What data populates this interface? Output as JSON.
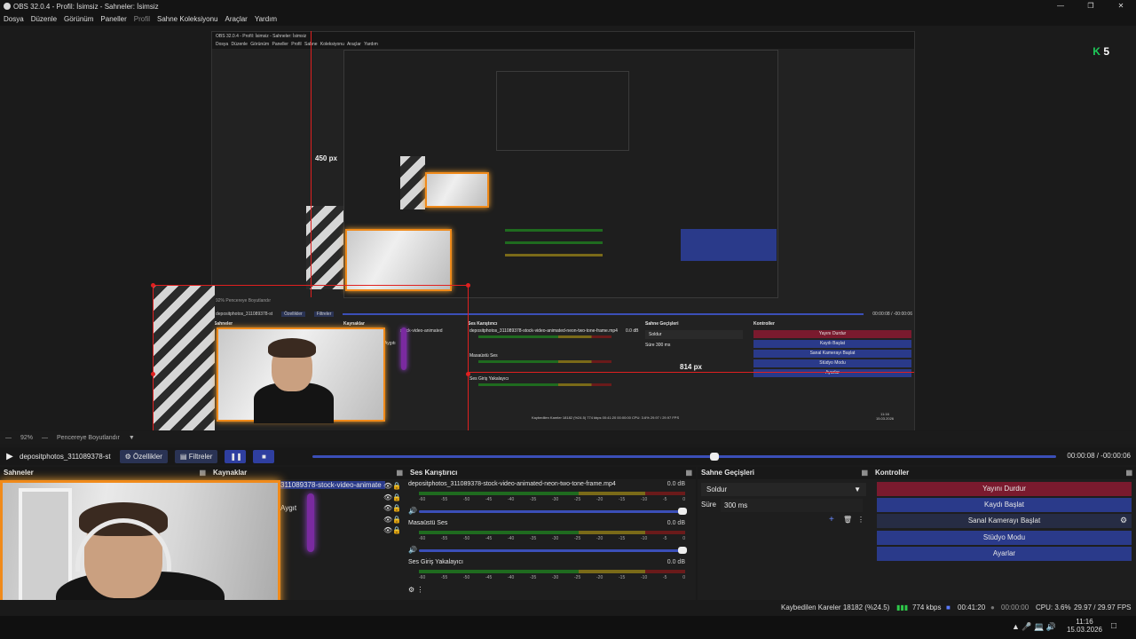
{
  "window": {
    "title": "OBS 32.0.4 - Profil: İsimsiz - Sahneler: İsimsiz"
  },
  "menu": [
    "Dosya",
    "Düzenle",
    "Görünüm",
    "Paneller",
    "Profil",
    "Sahne Koleksiyonu",
    "Araçlar",
    "Yardım"
  ],
  "logo": {
    "letter": "K",
    "num": "5"
  },
  "preview": {
    "inner_title": "OBS 32.0.4 - Profil: İsimsiz - Sahneler: İsimsiz",
    "inner_menu": "Dosya Düzenle Görünüm Paneller Profil Sahne Koleksiyonu Araçlar Yardım",
    "label_450": "450 px",
    "label_814": "814 px",
    "nested_source": "depositphotos_311089378-st",
    "nested_props": "Özellikler",
    "nested_filters": "Filtreler",
    "nested_time": "00:00:08 / -00:00:06",
    "nested_zoom": "92%",
    "nested_fit": "Pencereye Boyutlandır",
    "nested_scenes": "Sahneler",
    "nested_sources": "Kaynaklar",
    "nested_mixer": "Ses Karıştırıcı",
    "nested_trans": "Sahne Geçişleri",
    "nested_ctrl": "Kontroller",
    "nested_mix1": "depositphotos_311089378-stock-video-animated-neon-two-tone-frame.mp4",
    "nested_mix2": "Masaüstü Ses",
    "nested_mix3": "Ses Giriş Yakalayıcı",
    "nested_db": "0.0 dB",
    "nested_fade": "Soldur",
    "nested_dur_label": "Süre",
    "nested_dur": "300 ms",
    "nested_c1": "Yayını Durdur",
    "nested_c2": "Kaydı Başlat",
    "nested_c3": "Sanal Kamerayı Başlat",
    "nested_c4": "Stüdyo Modu",
    "nested_c5": "Ayarlar",
    "nested_src_item": "stock-video-animated",
    "nested_src_item2": "Aygıtı",
    "nested_status": "Kaybedilen Kareler 18182 (%24.5)    774 kbps    00:41:20    00:00:00   CPU: 3.6%  29.97 / 29.97 FPS",
    "nested_clock_time": "11:16",
    "nested_clock_date": "15.03.2026"
  },
  "statusrow": {
    "zoom": "92%",
    "fit": "Pencereye Boyutlandır"
  },
  "toolbar": {
    "source": "depositphotos_311089378-st",
    "props": "Özellikler",
    "filters": "Filtreler",
    "time": "00:00:08  /  -00:00:06",
    "seek_fraction": 0.54
  },
  "docks": {
    "scenes": "Sahneler",
    "sources": "Kaynaklar",
    "source_item": "311089378-stock-video-animate",
    "source_item2": "Aygıt",
    "mixer": "Ses Karıştırıcı",
    "transitions": "Sahne Geçişleri",
    "controls": "Kontroller"
  },
  "mixer": {
    "tracks": [
      {
        "name": "depositphotos_311089378-stock-video-animated-neon-two-tone-frame.mp4",
        "db": "0.0 dB"
      },
      {
        "name": "Masaüstü Ses",
        "db": "0.0 dB"
      },
      {
        "name": "Ses Giriş Yakalayıcı",
        "db": "0.0 dB"
      }
    ],
    "scale": [
      "-60",
      "-55",
      "-50",
      "-45",
      "-40",
      "-35",
      "-30",
      "-25",
      "-20",
      "-15",
      "-10",
      "-5",
      "0"
    ]
  },
  "transitions": {
    "type": "Soldur",
    "duration_label": "Süre",
    "duration": "300 ms"
  },
  "controls": [
    "Yayını Durdur",
    "Kaydı Başlat",
    "Sanal Kamerayı Başlat",
    "Stüdyo Modu",
    "Ayarlar"
  ],
  "footer": {
    "dropped": "Kaybedilen Kareler 18182 (%24.5)",
    "kbps": "774 kbps",
    "rec": "00:41:20",
    "stream": "00:00:00",
    "cpu": "CPU: 3.6%",
    "fps": "29.97 / 29.97 FPS"
  },
  "taskbar": {
    "time": "11:16",
    "date": "15.03.2026"
  },
  "colors": {
    "accent": "#3b4fb8",
    "danger": "#7a1a2e",
    "primary": "#2a3a8a",
    "neon": "#f08a1a",
    "meter_green": "#1f6b1f"
  }
}
